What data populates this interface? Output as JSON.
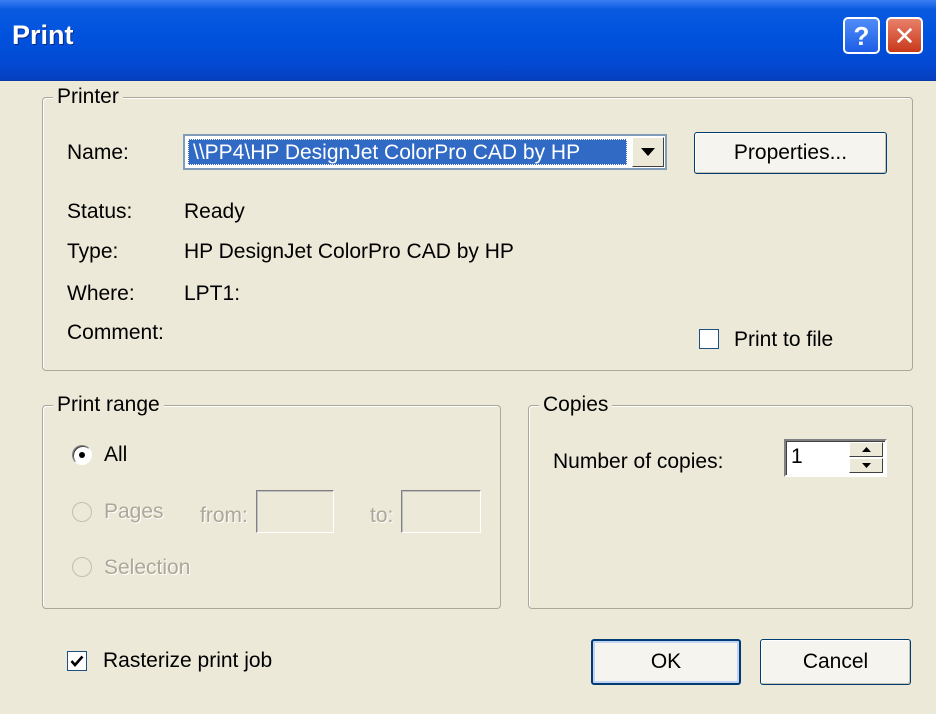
{
  "window": {
    "title": "Print"
  },
  "printer": {
    "group_label": "Printer",
    "name_label": "Name:",
    "name_value": "\\\\PP4\\HP DesignJet ColorPro CAD by HP",
    "properties_button": "Properties...",
    "status_label": "Status:",
    "status_value": "Ready",
    "type_label": "Type:",
    "type_value": "HP DesignJet ColorPro CAD by HP",
    "where_label": "Where:",
    "where_value": "LPT1:",
    "comment_label": "Comment:",
    "print_to_file_label": "Print to file",
    "print_to_file_checked": false
  },
  "print_range": {
    "group_label": "Print range",
    "all_label": "All",
    "pages_label": "Pages",
    "from_label": "from:",
    "to_label": "to:",
    "selection_label": "Selection",
    "selected": "All"
  },
  "copies": {
    "group_label": "Copies",
    "number_label": "Number of copies:",
    "number_value": "1"
  },
  "rasterize_label": "Rasterize print job",
  "rasterize_checked": true,
  "buttons": {
    "ok": "OK",
    "cancel": "Cancel"
  }
}
